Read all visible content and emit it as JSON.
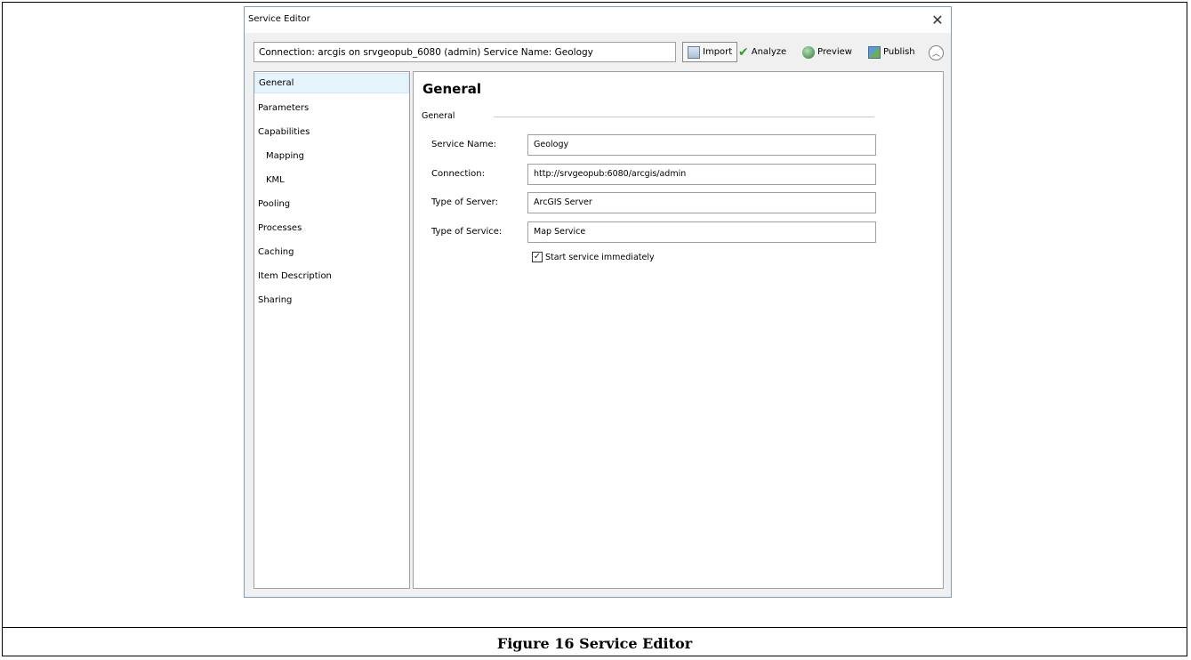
{
  "window": {
    "title": "Service Editor",
    "close_symbol": "✕"
  },
  "toolbar": {
    "connection_text": "Connection: arcgis on srvgeopub_6080 (admin)   Service Name: Geology",
    "import_label": "Import",
    "analyze_label": "Analyze",
    "preview_label": "Preview",
    "publish_label": "Publish",
    "collapse_symbol": "︿"
  },
  "nav": {
    "items": [
      {
        "label": "General",
        "selected": true
      },
      {
        "label": "Parameters"
      },
      {
        "label": "Capabilities"
      },
      {
        "label": "Mapping",
        "sub": true
      },
      {
        "label": "KML",
        "sub": true
      },
      {
        "label": "Pooling"
      },
      {
        "label": "Processes"
      },
      {
        "label": "Caching"
      },
      {
        "label": "Item Description"
      },
      {
        "label": "Sharing"
      }
    ]
  },
  "content": {
    "heading": "General",
    "group_label": "General",
    "fields": [
      {
        "label": "Service Name:",
        "value": "Geology"
      },
      {
        "label": "Connection:",
        "value": "http://srvgeopub:6080/arcgis/admin"
      },
      {
        "label": "Type of Server:",
        "value": "ArcGIS Server"
      },
      {
        "label": "Type of Service:",
        "value": "Map Service"
      }
    ],
    "start_checkbox_label": "Start service immediately",
    "start_checkbox_checked": true,
    "check_mark": "✓"
  },
  "caption": "Figure 16 Service Editor",
  "colors": {
    "selection_bg": "#e5f3fb",
    "window_border": "#7f9db9",
    "analyze_check": "#2e9e2e"
  }
}
